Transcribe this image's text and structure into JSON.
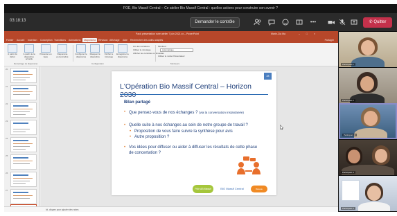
{
  "window": {
    "title": "FOE, Bio Massif Central – Ce atelier Bio Massif Central : quelles actions pour construire son avenir ?",
    "call_time": "03:18:13"
  },
  "meeting_bar": {
    "take_control": "Demander le contrôle",
    "leave": "Quitter",
    "icons": [
      "people-icon",
      "chat-icon",
      "reactions-icon",
      "rooms-icon",
      "more-icon",
      "camera-icon",
      "mic-icon",
      "share-icon"
    ]
  },
  "ppt": {
    "title": "Pack présentation ruée atelier 7 juin 2021.xx – PowerPoint",
    "user": "Marie-Cla Ma",
    "window_controls": "– □ ×",
    "share_label": "Partager",
    "menu": [
      "Fichier",
      "Accueil",
      "Insertion",
      "Conception",
      "Transitions",
      "Animations",
      "Diaporama",
      "Révision",
      "Affichage",
      "Aide",
      "Rechercher des outils adaptés"
    ],
    "active_menu_index": 6,
    "ribbon": {
      "buttons": [
        "À partir du début",
        "À partir de la diapositive actuelle",
        "Présenter en ligne",
        "Diaporama personnalisé",
        "Configurer le diaporama",
        "Masquer la diapositive",
        "Vérifier le minutage",
        "Enregistrer le diaporama"
      ],
      "checks": [
        "Lire les narrations",
        "Utiliser le minutage",
        "Afficher les contrôles multimédias"
      ],
      "monitor_label": "Moniteur :",
      "monitor_value": "Automatique",
      "presenter_view": "Utiliser le mode Présentateur",
      "groups": [
        "Démarrage du diaporama",
        "Configuration",
        "Moniteurs"
      ]
    },
    "notes": "Ici, cliquez pour ajouter des notes",
    "thumb_numbers": [
      "20",
      "21",
      "22",
      "23",
      "24",
      "25",
      "26",
      "27",
      "28"
    ],
    "selected_thumb_index": 8
  },
  "slide": {
    "title": "L'Opération Bio Massif Central – Horizon 2030",
    "number": "28",
    "subtitle": "Bilan partagé",
    "bullets": [
      {
        "text": "Que pensez-vous de nos échanges ?",
        "small": "(via la conversation instantanée)"
      },
      {
        "text": "Quelle suite à nos échanges au sein de notre groupe de travail ?"
      },
      {
        "text": "Vos idées pour diffuser ou aider à diffuser les résultats de cette phase de concertation ?"
      }
    ],
    "sub_bullets": [
      "Proposition de vous faire suivre la synthèse pour avis",
      "Autre proposition ?"
    ],
    "logos": [
      "Pôle AB Massif",
      "BIO Massif Central",
      "Réseau"
    ]
  },
  "gallery": {
    "participants": [
      "Participant 1",
      "Participant 2",
      "Participant 3",
      "Participant 4",
      "Participant 5"
    ]
  },
  "colors": {
    "ppt_accent": "#b7472a",
    "teams_leave": "#c4314b",
    "slide_blue": "#1f3f7a",
    "slide_orange": "#e07a2a"
  }
}
